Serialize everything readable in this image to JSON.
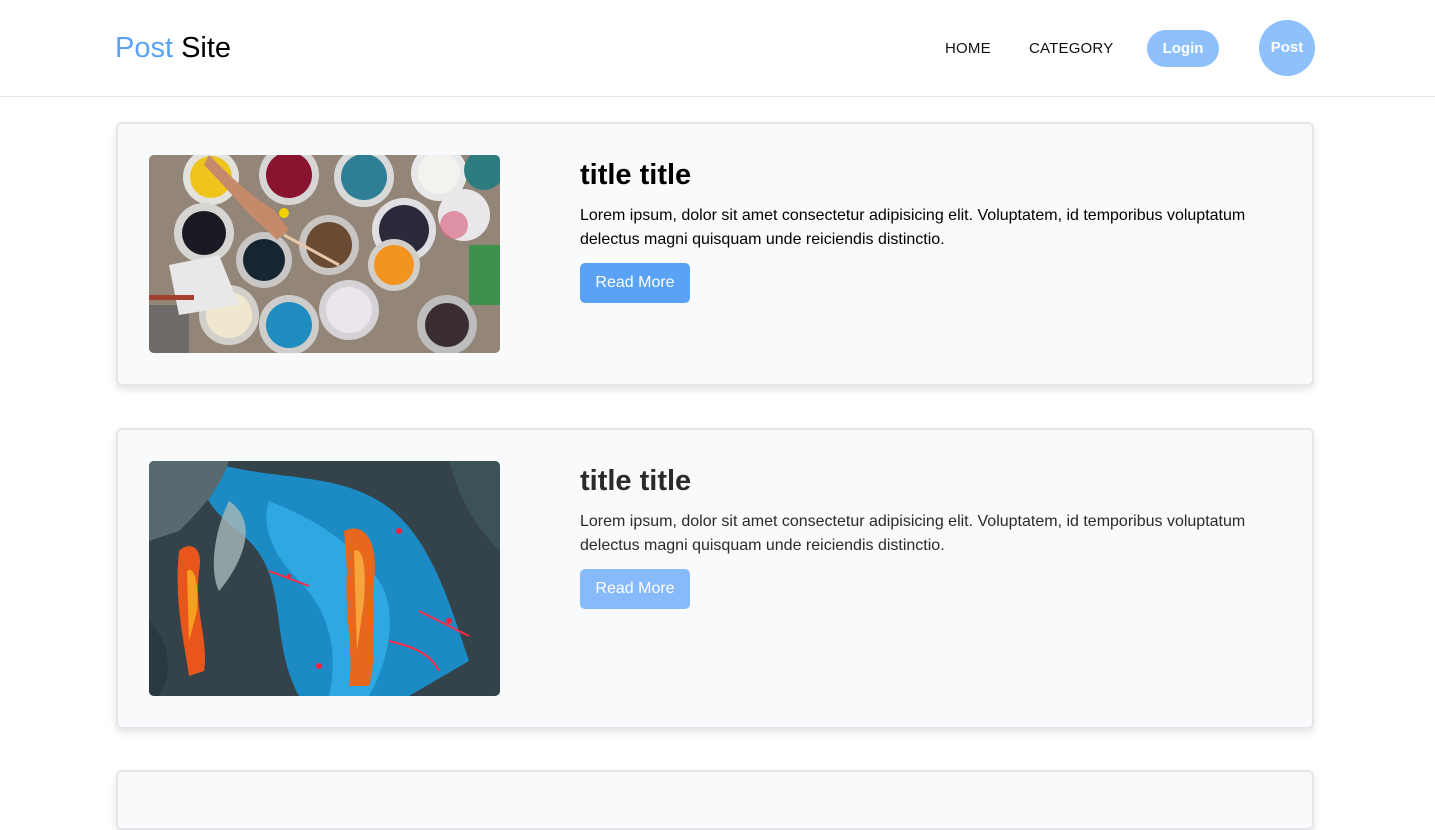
{
  "header": {
    "logo": {
      "accent": "Post",
      "rest": " Site"
    },
    "nav": {
      "home": "HOME",
      "category": "CATEGORY"
    },
    "login_label": "Login",
    "post_label": "Post"
  },
  "posts": [
    {
      "title": "title title",
      "excerpt": "Lorem ipsum, dolor sit amet consectetur adipisicing elit. Voluptatem, id temporibus voluptatum delectus magni quisquam unde reiciendis distinctio.",
      "button": "Read More",
      "image": "paint-cans-photo"
    },
    {
      "title": "title title",
      "excerpt": "Lorem ipsum, dolor sit amet consectetur adipisicing elit. Voluptatem, id temporibus voluptatum delectus magni quisquam unde reiciendis distinctio.",
      "button": "Read More",
      "image": "abstract-painting-photo"
    }
  ],
  "colors": {
    "accent": "#5aa2f5",
    "accent_light": "#8ec0fb",
    "card_bg": "#f9fafc"
  }
}
